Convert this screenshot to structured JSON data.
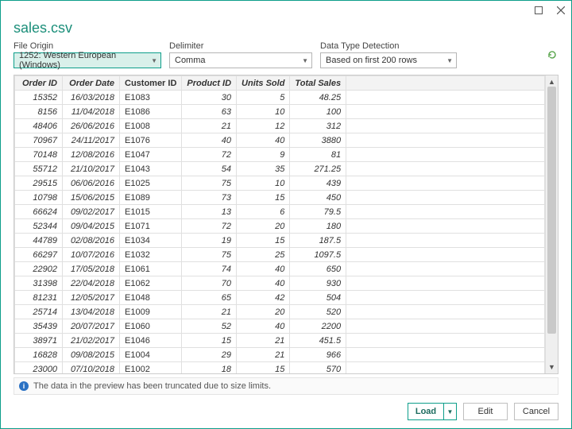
{
  "window": {
    "title": "sales.csv"
  },
  "options": {
    "fileOrigin": {
      "label": "File Origin",
      "value": "1252: Western European (Windows)"
    },
    "delimiter": {
      "label": "Delimiter",
      "value": "Comma"
    },
    "dataType": {
      "label": "Data Type Detection",
      "value": "Based on first 200 rows"
    }
  },
  "columns": [
    "Order ID",
    "Order Date",
    "Customer ID",
    "Product ID",
    "Units Sold",
    "Total Sales"
  ],
  "rows": [
    {
      "c0": "15352",
      "c1": "16/03/2018",
      "c2": "E1083",
      "c3": "30",
      "c4": "5",
      "c5": "48.25"
    },
    {
      "c0": "8156",
      "c1": "11/04/2018",
      "c2": "E1086",
      "c3": "63",
      "c4": "10",
      "c5": "100"
    },
    {
      "c0": "48406",
      "c1": "26/06/2016",
      "c2": "E1008",
      "c3": "21",
      "c4": "12",
      "c5": "312"
    },
    {
      "c0": "70967",
      "c1": "24/11/2017",
      "c2": "E1076",
      "c3": "40",
      "c4": "40",
      "c5": "3880"
    },
    {
      "c0": "70148",
      "c1": "12/08/2016",
      "c2": "E1047",
      "c3": "72",
      "c4": "9",
      "c5": "81"
    },
    {
      "c0": "55712",
      "c1": "21/10/2017",
      "c2": "E1043",
      "c3": "54",
      "c4": "35",
      "c5": "271.25"
    },
    {
      "c0": "29515",
      "c1": "06/06/2016",
      "c2": "E1025",
      "c3": "75",
      "c4": "10",
      "c5": "439"
    },
    {
      "c0": "10798",
      "c1": "15/06/2015",
      "c2": "E1089",
      "c3": "73",
      "c4": "15",
      "c5": "450"
    },
    {
      "c0": "66624",
      "c1": "09/02/2017",
      "c2": "E1015",
      "c3": "13",
      "c4": "6",
      "c5": "79.5"
    },
    {
      "c0": "52344",
      "c1": "09/04/2015",
      "c2": "E1071",
      "c3": "72",
      "c4": "20",
      "c5": "180"
    },
    {
      "c0": "44789",
      "c1": "02/08/2016",
      "c2": "E1034",
      "c3": "19",
      "c4": "15",
      "c5": "187.5"
    },
    {
      "c0": "66297",
      "c1": "10/07/2016",
      "c2": "E1032",
      "c3": "75",
      "c4": "25",
      "c5": "1097.5"
    },
    {
      "c0": "22902",
      "c1": "17/05/2018",
      "c2": "E1061",
      "c3": "74",
      "c4": "40",
      "c5": "650"
    },
    {
      "c0": "31398",
      "c1": "22/04/2018",
      "c2": "E1062",
      "c3": "70",
      "c4": "40",
      "c5": "930"
    },
    {
      "c0": "81231",
      "c1": "12/05/2017",
      "c2": "E1048",
      "c3": "65",
      "c4": "42",
      "c5": "504"
    },
    {
      "c0": "25714",
      "c1": "13/04/2018",
      "c2": "E1009",
      "c3": "21",
      "c4": "20",
      "c5": "520"
    },
    {
      "c0": "35439",
      "c1": "20/07/2017",
      "c2": "E1060",
      "c3": "52",
      "c4": "40",
      "c5": "2200"
    },
    {
      "c0": "38971",
      "c1": "21/02/2017",
      "c2": "E1046",
      "c3": "15",
      "c4": "21",
      "c5": "451.5"
    },
    {
      "c0": "16828",
      "c1": "09/08/2015",
      "c2": "E1004",
      "c3": "29",
      "c4": "21",
      "c5": "966"
    },
    {
      "c0": "23000",
      "c1": "07/10/2018",
      "c2": "E1002",
      "c3": "18",
      "c4": "15",
      "c5": "570"
    }
  ],
  "info": {
    "truncated": "The data in the preview has been truncated due to size limits."
  },
  "buttons": {
    "load": "Load",
    "edit": "Edit",
    "cancel": "Cancel"
  }
}
